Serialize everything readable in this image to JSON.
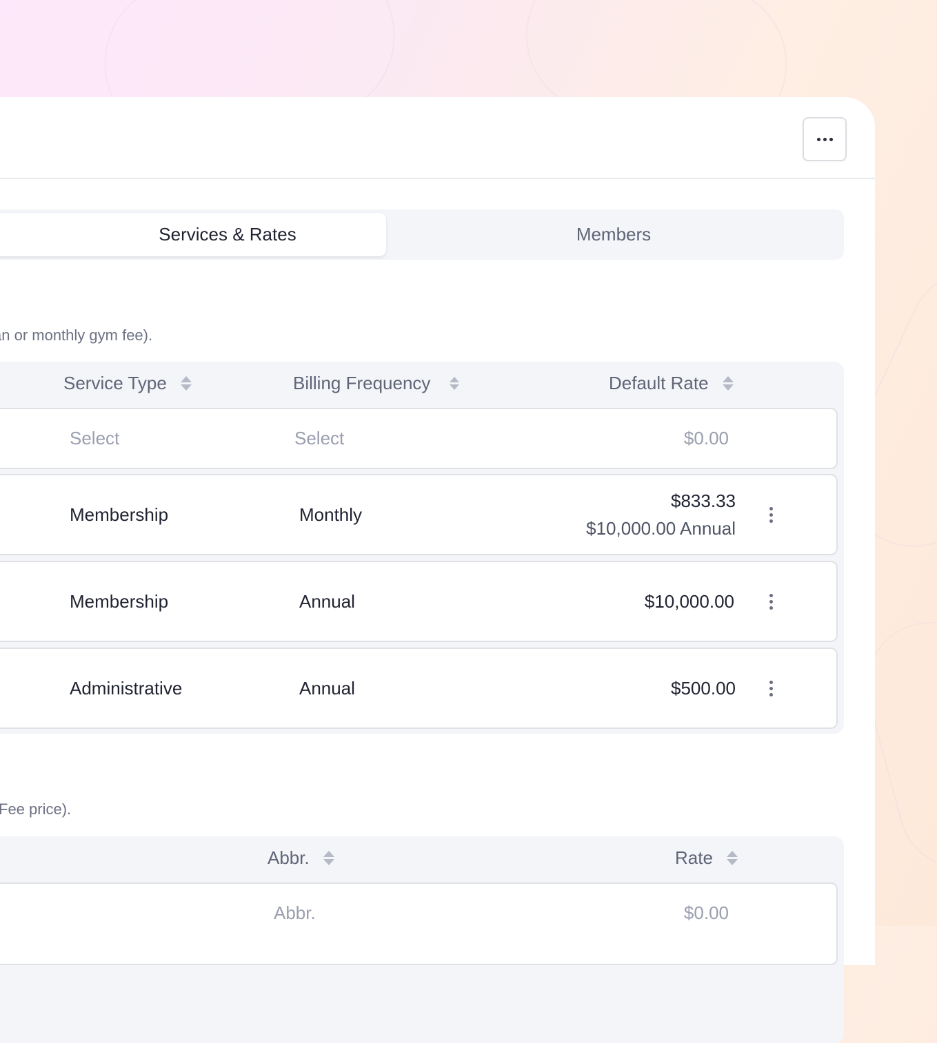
{
  "more_button_label": "More options",
  "tabs": [
    {
      "label": "Services & Rates",
      "active": true
    },
    {
      "label": "Members",
      "active": false
    }
  ],
  "services": {
    "description": "an or monthly gym fee).",
    "columns": {
      "service_type": "Service Type",
      "billing_frequency": "Billing Frequency",
      "default_rate": "Default Rate"
    },
    "new_row": {
      "service_type_placeholder": "Select",
      "billing_frequency_placeholder": "Select",
      "rate_placeholder": "$0.00"
    },
    "rows": [
      {
        "service_type": "Membership",
        "billing_frequency": "Monthly",
        "rate": "$833.33",
        "rate_sub": "$10,000.00 Annual"
      },
      {
        "service_type": "Membership",
        "billing_frequency": "Annual",
        "rate": "$10,000.00"
      },
      {
        "service_type": "Administrative",
        "billing_frequency": "Annual",
        "rate": "$500.00"
      }
    ]
  },
  "fees": {
    "description": "Fee price).",
    "columns": {
      "abbr": "Abbr.",
      "rate": "Rate"
    },
    "new_row": {
      "abbr_placeholder": "Abbr.",
      "rate_placeholder": "$0.00"
    }
  }
}
